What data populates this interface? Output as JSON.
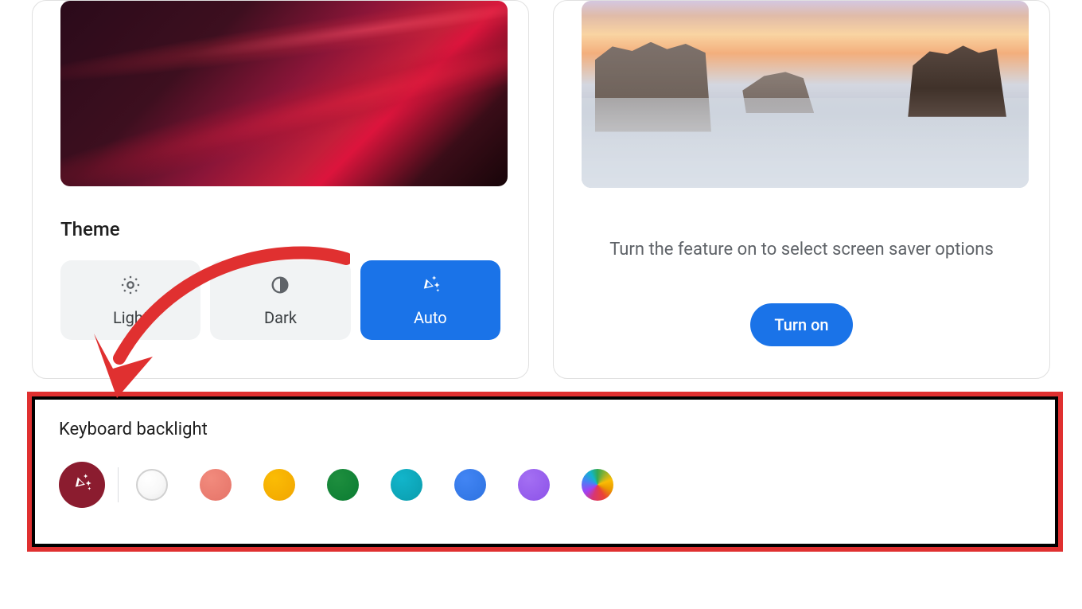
{
  "wallpaper_card": {
    "theme_label": "Theme",
    "light_label": "Light",
    "dark_label": "Dark",
    "auto_label": "Auto",
    "selected": "auto"
  },
  "screensaver_card": {
    "description": "Turn the feature on to select screen saver options",
    "button_label": "Turn on"
  },
  "backlight": {
    "title": "Keyboard backlight",
    "colors": {
      "auto": "#8b1c2f",
      "white": "#ffffff",
      "red": "#e57368",
      "yellow": "#fbbc05",
      "green": "#1e8e3e",
      "teal": "#12b5cb",
      "blue": "#4285f4",
      "purple": "#a46ff3",
      "rainbow": "rainbow"
    },
    "selected": "auto"
  },
  "annotation": {
    "arrow_color": "#e03030",
    "highlight_border": "#e03030"
  }
}
